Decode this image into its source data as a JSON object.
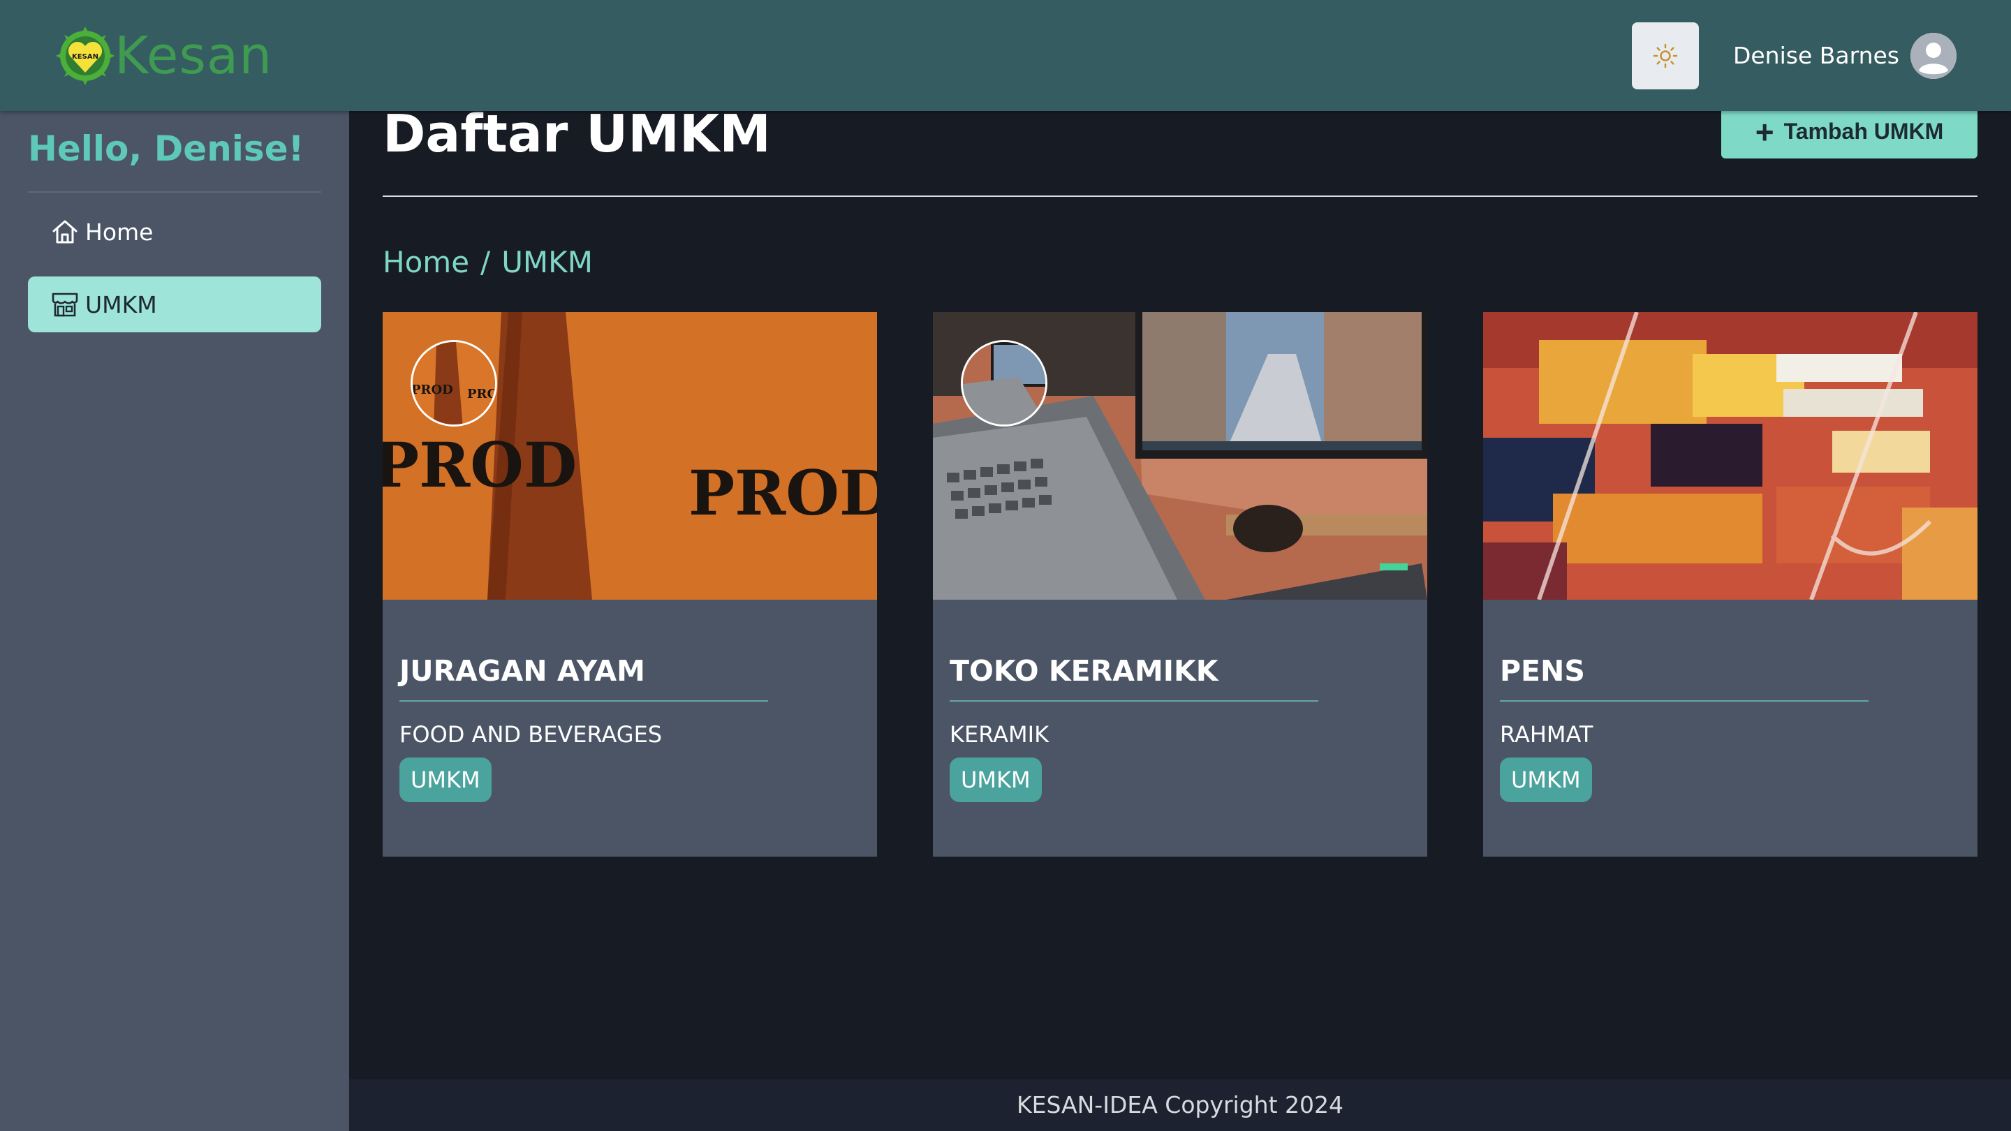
{
  "header": {
    "brand": "Kesan",
    "logo_text": "KESAN",
    "user_name": "Denise Barnes"
  },
  "sidebar": {
    "greeting": "Hello, Denise!",
    "items": [
      {
        "label": "Home",
        "icon": "home-icon",
        "active": false
      },
      {
        "label": "UMKM",
        "icon": "store-icon",
        "active": true
      }
    ]
  },
  "main": {
    "title": "Daftar UMKM",
    "add_button": "Tambah UMKM",
    "breadcrumb": [
      "Home",
      "UMKM"
    ],
    "cards": [
      {
        "title": "JURAGAN AYAM",
        "category": "FOOD AND BEVERAGES",
        "badge": "UMKM",
        "image_text": "PROD"
      },
      {
        "title": "TOKO KERAMIKK",
        "category": "KERAMIK",
        "badge": "UMKM"
      },
      {
        "title": "PENS",
        "category": "RAHMAT",
        "badge": "UMKM"
      }
    ]
  },
  "footer": {
    "text": "KESAN-IDEA Copyright 2024"
  },
  "colors": {
    "topbar": "#355c60",
    "sidebar": "#4b5566",
    "background": "#171b24",
    "accent": "#7fd9c7",
    "badge": "#4aa39c",
    "greeting": "#5ec9b6"
  }
}
